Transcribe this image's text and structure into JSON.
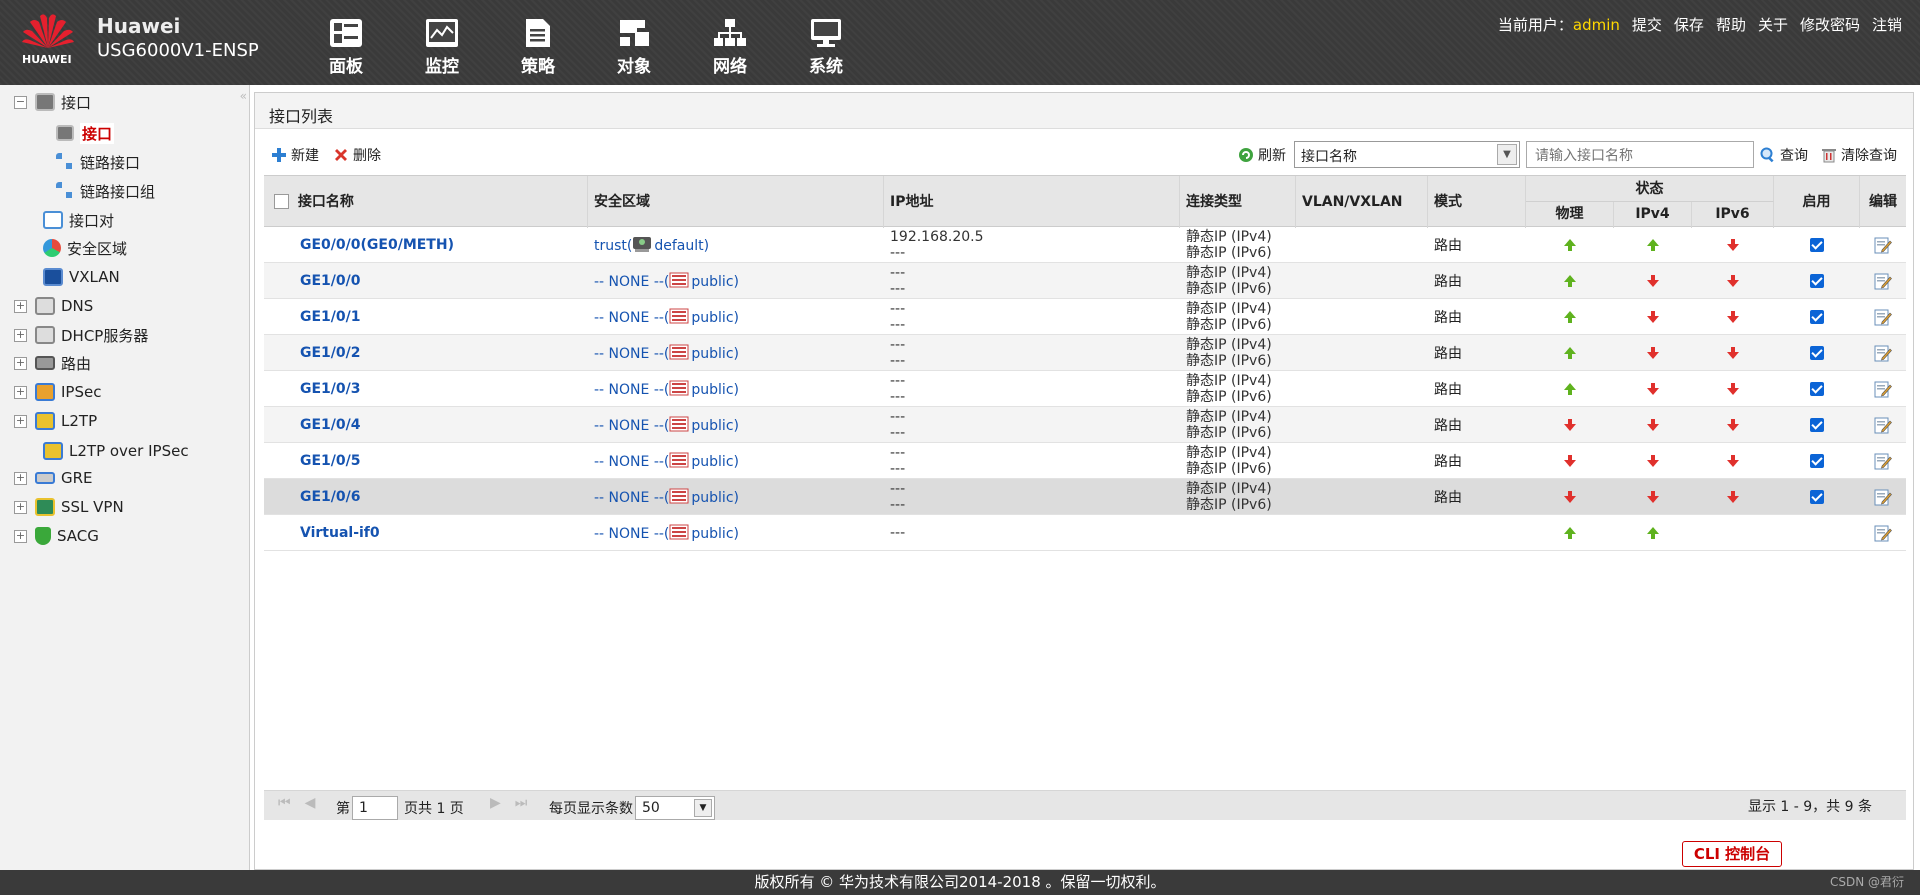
{
  "header": {
    "brand": "Huawei",
    "model": "USG6000V1-ENSP",
    "logo_text": "HUAWEI",
    "menu": [
      {
        "label": "面板",
        "icon": "dashboard-icon"
      },
      {
        "label": "监控",
        "icon": "monitor-icon"
      },
      {
        "label": "策略",
        "icon": "policy-icon"
      },
      {
        "label": "对象",
        "icon": "object-icon"
      },
      {
        "label": "网络",
        "icon": "network-icon"
      },
      {
        "label": "系统",
        "icon": "system-icon"
      }
    ],
    "current_user_label": "当前用户：",
    "current_user": "admin",
    "links": [
      "提交",
      "保存",
      "帮助",
      "关于",
      "修改密码",
      "注销"
    ]
  },
  "sidebar": {
    "items": [
      {
        "label": "接口",
        "toggle": "−",
        "icon": "interface-icon"
      },
      {
        "label": "接口",
        "selected": true,
        "icon": "interface-icon"
      },
      {
        "label": "链路接口",
        "icon": "link-icon"
      },
      {
        "label": "链路接口组",
        "icon": "link-group-icon"
      },
      {
        "label": "接口对",
        "icon": "interface-pair-icon"
      },
      {
        "label": "安全区域",
        "icon": "security-zone-icon"
      },
      {
        "label": "VXLAN",
        "icon": "vxlan-icon"
      },
      {
        "label": "DNS",
        "toggle": "+",
        "icon": "dns-icon"
      },
      {
        "label": "DHCP服务器",
        "toggle": "+",
        "icon": "dhcp-icon"
      },
      {
        "label": "路由",
        "toggle": "+",
        "icon": "route-icon"
      },
      {
        "label": "IPSec",
        "toggle": "+",
        "icon": "ipsec-icon"
      },
      {
        "label": "L2TP",
        "toggle": "+",
        "icon": "l2tp-icon"
      },
      {
        "label": "L2TP over IPSec",
        "icon": "l2tp-ipsec-icon"
      },
      {
        "label": "GRE",
        "toggle": "+",
        "icon": "gre-icon"
      },
      {
        "label": "SSL VPN",
        "toggle": "+",
        "icon": "sslvpn-icon"
      },
      {
        "label": "SACG",
        "toggle": "+",
        "icon": "sacg-icon"
      }
    ]
  },
  "page": {
    "title": "接口列表",
    "new_label": "新建",
    "delete_label": "删除",
    "refresh_label": "刷新",
    "filter_field": "接口名称",
    "search_placeholder": "请输入接口名称",
    "query_label": "查询",
    "clear_label": "清除查询"
  },
  "table": {
    "headers": {
      "name": "接口名称",
      "zone": "安全区域",
      "ip": "IP地址",
      "conn": "连接类型",
      "vlan": "VLAN/VXLAN",
      "mode": "模式",
      "status": "状态",
      "phys": "物理",
      "ipv4": "IPv4",
      "ipv6": "IPv6",
      "enable": "启用",
      "edit": "编辑"
    },
    "rows": [
      {
        "name": "GE0/0/0(GE0/METH)",
        "zone": "trust(",
        "vsys": "default)",
        "ip1": "192.168.20.5",
        "ip2": "---",
        "conn1": "静态IP (IPv4)",
        "conn2": "静态IP (IPv6)",
        "mode": "路由",
        "phys": "up",
        "ipv4": "up",
        "ipv6": "down",
        "enabled": true
      },
      {
        "name": "GE1/0/0",
        "zone": "-- NONE --(",
        "vsys": "public)",
        "ip1": "---",
        "ip2": "---",
        "conn1": "静态IP (IPv4)",
        "conn2": "静态IP (IPv6)",
        "mode": "路由",
        "phys": "up",
        "ipv4": "down",
        "ipv6": "down",
        "enabled": true
      },
      {
        "name": "GE1/0/1",
        "zone": "-- NONE --(",
        "vsys": "public)",
        "ip1": "---",
        "ip2": "---",
        "conn1": "静态IP (IPv4)",
        "conn2": "静态IP (IPv6)",
        "mode": "路由",
        "phys": "up",
        "ipv4": "down",
        "ipv6": "down",
        "enabled": true
      },
      {
        "name": "GE1/0/2",
        "zone": "-- NONE --(",
        "vsys": "public)",
        "ip1": "---",
        "ip2": "---",
        "conn1": "静态IP (IPv4)",
        "conn2": "静态IP (IPv6)",
        "mode": "路由",
        "phys": "up",
        "ipv4": "down",
        "ipv6": "down",
        "enabled": true
      },
      {
        "name": "GE1/0/3",
        "zone": "-- NONE --(",
        "vsys": "public)",
        "ip1": "---",
        "ip2": "---",
        "conn1": "静态IP (IPv4)",
        "conn2": "静态IP (IPv6)",
        "mode": "路由",
        "phys": "up",
        "ipv4": "down",
        "ipv6": "down",
        "enabled": true
      },
      {
        "name": "GE1/0/4",
        "zone": "-- NONE --(",
        "vsys": "public)",
        "ip1": "---",
        "ip2": "---",
        "conn1": "静态IP (IPv4)",
        "conn2": "静态IP (IPv6)",
        "mode": "路由",
        "phys": "down",
        "ipv4": "down",
        "ipv6": "down",
        "enabled": true
      },
      {
        "name": "GE1/0/5",
        "zone": "-- NONE --(",
        "vsys": "public)",
        "ip1": "---",
        "ip2": "---",
        "conn1": "静态IP (IPv4)",
        "conn2": "静态IP (IPv6)",
        "mode": "路由",
        "phys": "down",
        "ipv4": "down",
        "ipv6": "down",
        "enabled": true
      },
      {
        "name": "GE1/0/6",
        "zone": "-- NONE --(",
        "vsys": "public)",
        "ip1": "---",
        "ip2": "---",
        "conn1": "静态IP (IPv4)",
        "conn2": "静态IP (IPv6)",
        "mode": "路由",
        "phys": "down",
        "ipv4": "down",
        "ipv6": "down",
        "enabled": true
      },
      {
        "name": "Virtual-if0",
        "zone": "-- NONE --(",
        "vsys": "public)",
        "ip1": "---",
        "ip2": "",
        "conn1": "",
        "conn2": "",
        "mode": "",
        "phys": "up",
        "ipv4": "up",
        "ipv6": "",
        "enabled": null
      }
    ]
  },
  "pager": {
    "page_label": "第",
    "page": "1",
    "total_label": "页共 1 页",
    "per_page_label": "每页显示条数",
    "per_page": "50",
    "summary": "显示 1 - 9，共 9 条"
  },
  "footer": {
    "copyright": "版权所有 © 华为技术有限公司2014-2018 。保留一切权利。",
    "cli_label": "CLI 控制台",
    "watermark": "CSDN @君衍"
  },
  "colors": {
    "up": "#5fb21e",
    "down": "#e0302c",
    "link": "#1553b0",
    "accent": "#c00000"
  }
}
